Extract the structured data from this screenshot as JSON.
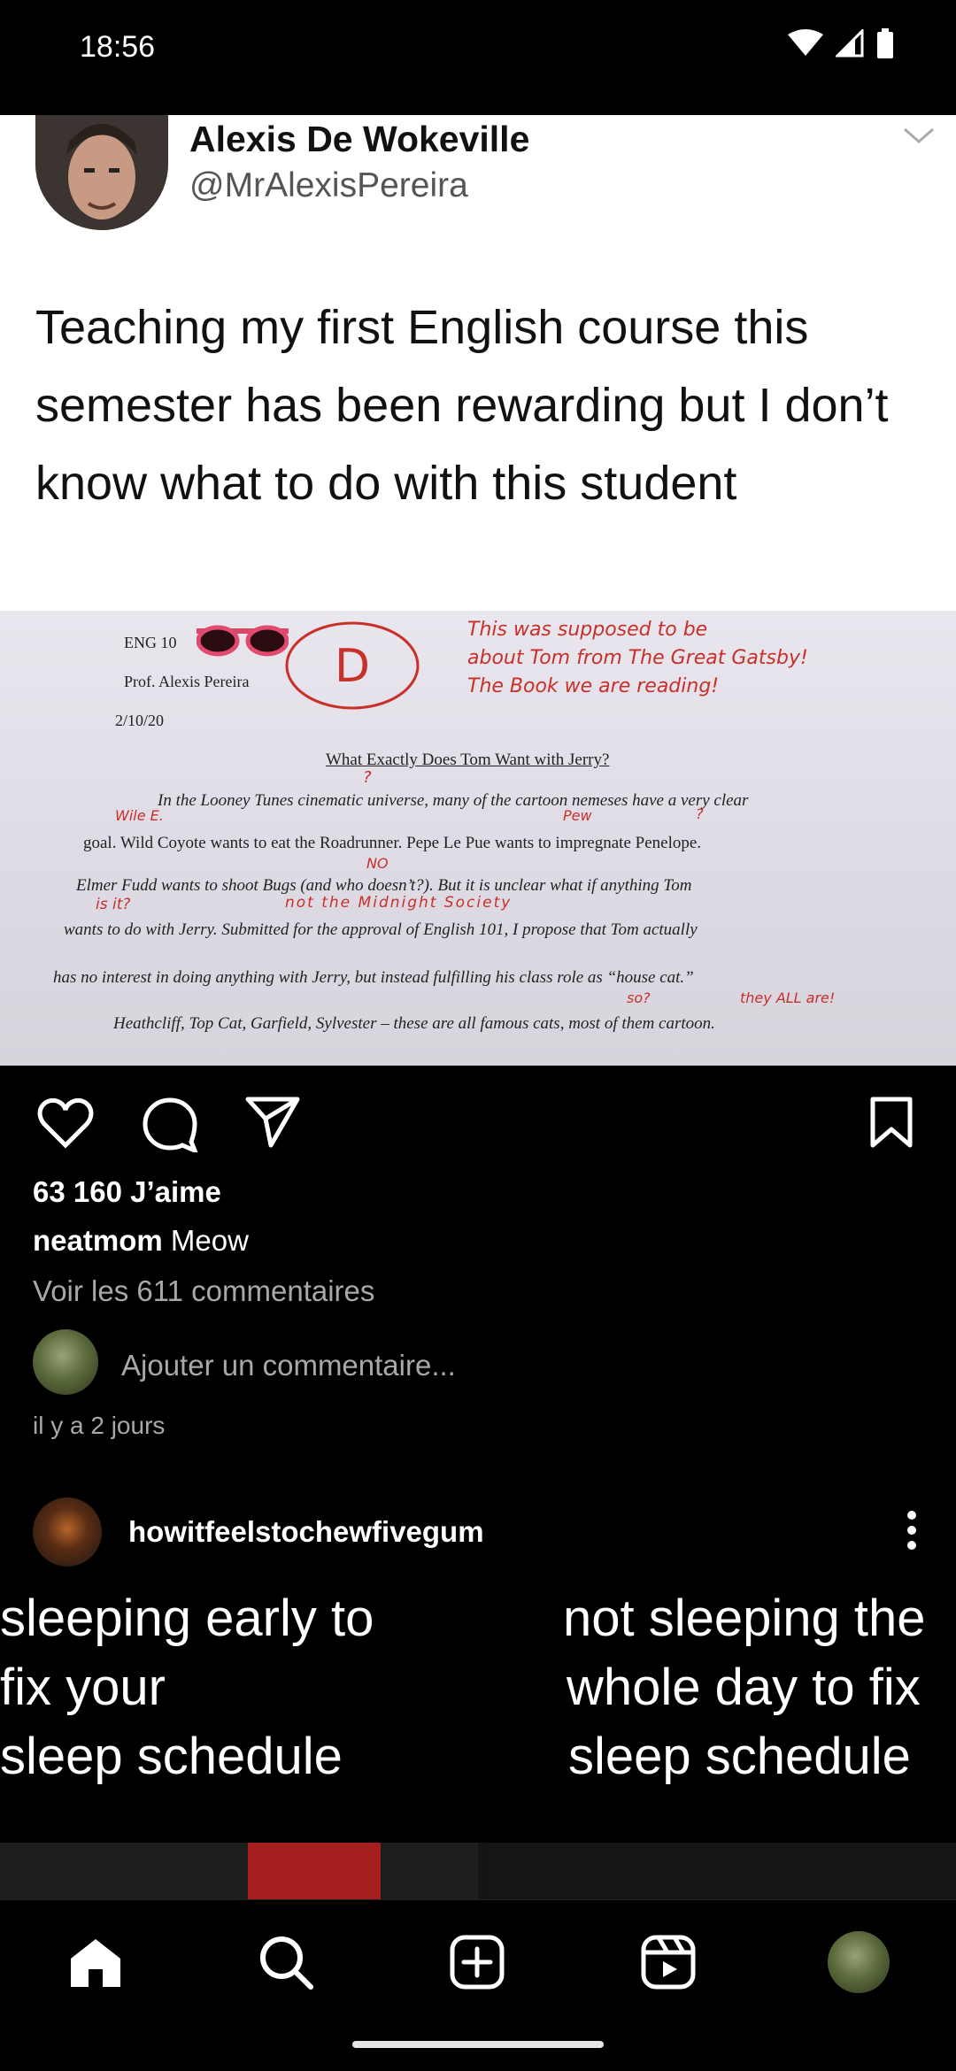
{
  "status_bar": {
    "time": "18:56"
  },
  "tweet": {
    "name": "Alexis De Wokeville",
    "handle": "@MrAlexisPereira",
    "text": "Teaching my first English course this semester has been rewarding but I don’t know what to do with this student"
  },
  "paper": {
    "course": "ENG 10",
    "prof": "Prof. Alexis Pereira",
    "date": "2/10/20",
    "grade": "D",
    "note_red": [
      "This was supposed to be",
      "about Tom from The Great Gatsby!",
      "The Book we are reading!"
    ],
    "title": "What Exactly Does Tom Want with Jerry?",
    "lines": [
      "In the Looney Tunes cinematic universe, many of the cartoon nemeses have a very clear",
      "goal. Wild Coyote wants to eat the Roadrunner. Pepe Le Pue wants to impregnate Penelope.",
      "Elmer Fudd wants to shoot Bugs (and who doesn’t?). But it is unclear what if anything Tom",
      "wants to do with Jerry. Submitted for the approval of English 101, I propose that Tom actually",
      "has no interest in doing anything with Jerry, but instead fulfilling his class role as “house cat.”",
      "Heathcliff, Top Cat, Garfield, Sylvester – these are all famous cats, most of them cartoon."
    ],
    "red_marks": [
      "?",
      "Wile E.",
      "Pew",
      "?",
      "NO",
      "is it?",
      "not the Midnight Society",
      "so?",
      "they ALL are!"
    ]
  },
  "post": {
    "likes": "63 160 J’aime",
    "caption_user": "neatmom",
    "caption_text": "Meow",
    "view_comments": "Voir les 611 commentaires",
    "add_comment_placeholder": "Ajouter un commentaire...",
    "time_ago": "il y a 2 jours"
  },
  "next_post": {
    "username": "howitfeelstochewfivegum",
    "meme_left": [
      "sleeping early to",
      "fix your",
      "sleep schedule"
    ],
    "meme_right": [
      "not sleeping the",
      "whole day to fix",
      "sleep schedule"
    ]
  },
  "icons": {
    "like": "heart-icon",
    "comment": "comment-icon",
    "share": "send-icon",
    "save": "bookmark-icon",
    "more": "more-vertical-icon",
    "home": "home-icon",
    "search": "search-icon",
    "create": "add-square-icon",
    "reels": "reels-icon"
  },
  "colors": {
    "background": "#000000",
    "secondary_text": "#a8a8a8",
    "ink_red": "#c8302a"
  }
}
